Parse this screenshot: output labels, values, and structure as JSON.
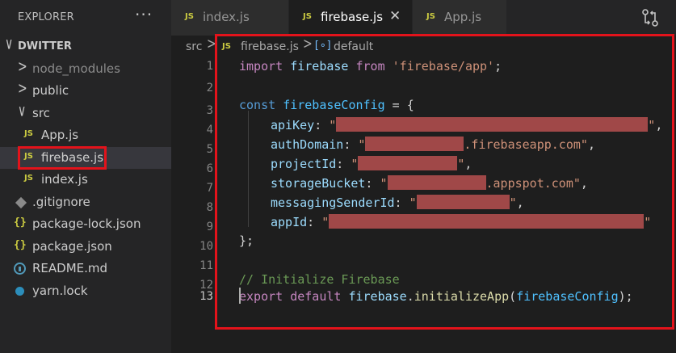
{
  "sidebar": {
    "title": "EXPLORER",
    "more_icon": "ellipsis-icon",
    "tree": [
      {
        "label": "DWITTER",
        "chevron": "∨",
        "type": "root"
      },
      {
        "label": "node_modules",
        "chevron": ">",
        "type": "folder"
      },
      {
        "label": "public",
        "chevron": ">",
        "type": "folder"
      },
      {
        "label": "src",
        "chevron": "∨",
        "type": "folder"
      },
      {
        "label": "App.js",
        "icon": "JS",
        "type": "file"
      },
      {
        "label": "firebase.js",
        "icon": "JS",
        "type": "file"
      },
      {
        "label": "index.js",
        "icon": "JS",
        "type": "file"
      },
      {
        "label": ".gitignore",
        "icon": "git-icon",
        "type": "file"
      },
      {
        "label": "package-lock.json",
        "icon": "{}",
        "type": "file"
      },
      {
        "label": "package.json",
        "icon": "{}",
        "type": "file"
      },
      {
        "label": "README.md",
        "icon": "info-icon",
        "type": "file"
      },
      {
        "label": "yarn.lock",
        "icon": "yarn-icon",
        "type": "file"
      }
    ]
  },
  "tabs": [
    {
      "label": "index.js",
      "icon": "JS"
    },
    {
      "label": "firebase.js",
      "icon": "JS",
      "close": "✕"
    },
    {
      "label": "App.js",
      "icon": "JS"
    }
  ],
  "breadcrumb": {
    "folder": "src",
    "sep": ">",
    "file_icon": "JS",
    "file": "firebase.js",
    "symbol_icon": "[∘]",
    "symbol": "default"
  },
  "editor": {
    "line_numbers": [
      "1",
      "2",
      "3",
      "4",
      "5",
      "6",
      "7",
      "8",
      "9",
      "10",
      "11",
      "12",
      "13"
    ],
    "current_line": "13",
    "code": {
      "l1": {
        "import": "import",
        "name": "firebase",
        "from": "from",
        "src": "'firebase/app'",
        "end": ";"
      },
      "l3": {
        "const": "const",
        "name": "firebaseConfig",
        "eq": " = {"
      },
      "l4": {
        "key": "apiKey",
        "q1": "\"",
        "q2": "\"",
        "end": ","
      },
      "l5": {
        "key": "authDomain",
        "q1": "\"",
        "tail": ".firebaseapp.com\"",
        "end": ","
      },
      "l6": {
        "key": "projectId",
        "q1": "\"",
        "q2": "\"",
        "end": ","
      },
      "l7": {
        "key": "storageBucket",
        "q1": "\"",
        "tail": ".appspot.com\"",
        "end": ","
      },
      "l8": {
        "key": "messagingSenderId",
        "q1": "\"",
        "q2": "\"",
        "end": ","
      },
      "l9": {
        "key": "appId",
        "q1": "\"",
        "q2": "\"",
        "end": ""
      },
      "l10": {
        "text": "};"
      },
      "l12": {
        "comment": "// Initialize Firebase"
      },
      "l13": {
        "export": "export",
        "default": "default",
        "obj": "firebase",
        "dot": ".",
        "fn": "initializeApp",
        "open": "(",
        "arg": "firebaseConfig",
        "close": ");"
      }
    }
  },
  "colors": {
    "highlight_border": "#e3131b",
    "redaction": "#a04848",
    "js_icon": "#cbcb41"
  }
}
